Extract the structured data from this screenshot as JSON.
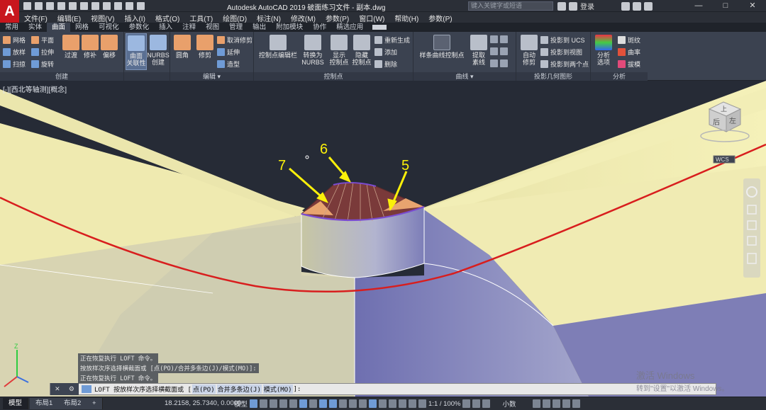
{
  "app": {
    "logo": "A",
    "title": "Autodesk AutoCAD 2019    破面练习文件 - 副本.dwg",
    "search_placeholder": "键入关键字或短语",
    "login": "登录",
    "win_controls": [
      "—",
      "□",
      "✕"
    ]
  },
  "menu": [
    "文件(F)",
    "编辑(E)",
    "视图(V)",
    "插入(I)",
    "格式(O)",
    "工具(T)",
    "绘图(D)",
    "标注(N)",
    "修改(M)",
    "参数(P)",
    "窗口(W)",
    "帮助(H)",
    "参数(P)"
  ],
  "tabs": [
    "常用",
    "实体",
    "曲面",
    "网格",
    "可视化",
    "参数化",
    "插入",
    "注释",
    "视图",
    "管理",
    "输出",
    "附加模块",
    "协作",
    "精选应用"
  ],
  "active_tab": "曲面",
  "ribbon": {
    "create_small": [
      "网格",
      "平面",
      "放样",
      "拉伸",
      "扫掠",
      "旋转"
    ],
    "create_big": [
      "过渡",
      "修补",
      "偏移",
      "曲面\n关联性",
      "NURBS\n创建"
    ],
    "create_title": "创建",
    "edit_big": [
      "圆角",
      "修剪"
    ],
    "edit_small": [
      "取消修剪",
      "延伸",
      "造型"
    ],
    "edit_title": "编辑 ▾",
    "cp_big": [
      "控制点编辑栏",
      "转换为\nNURBS",
      "显示\n控制点",
      "隐藏\n控制点"
    ],
    "cp_small": [
      "重新生成",
      "添加",
      "删除"
    ],
    "cp_title": "控制点",
    "curve_big": [
      "样条曲线控制点",
      "提取\n素线"
    ],
    "curve_title": "曲线 ▾",
    "proj_big": [
      "自动\n修剪"
    ],
    "proj_small": [
      "投影到 UCS",
      "投影到视图",
      "投影到两个点"
    ],
    "proj_title": "投影几何图形",
    "anal_big": [
      "分析\n选项"
    ],
    "anal_small": [
      "斑纹",
      "曲率",
      "拔模"
    ],
    "anal_title": "分析"
  },
  "viewport": {
    "label": "[-][西北等轴测][概念]",
    "viewcube_top": "上",
    "viewcube_left": "后",
    "viewcube_right": "左",
    "wcs": "WCS",
    "annotations": [
      "7",
      "6",
      "5"
    ]
  },
  "command_history": [
    "正在恢复执行 LOFT 命令。",
    "按放样次序选择横截面或 [点(PO)/合并多条边(J)/模式(MO)]:",
    "正在恢复执行 LOFT 命令。"
  ],
  "command_line": {
    "prefix": "LOFT 按放样次序选择横截面或 [",
    "opt1": "点(PO)",
    "opt2": "合并多条边(J)",
    "opt3": "模式(MO)",
    "suffix": "]:"
  },
  "statusbar": {
    "layout_tabs": [
      "模型",
      "布局1",
      "布局2",
      "+"
    ],
    "coords": "18.2158, 25.7340, 0.0000",
    "model": "模型",
    "scale": "1:1 / 100%",
    "units": "小数"
  },
  "watermark": {
    "line1": "激活 Windows",
    "line2": "转到\"设置\"以激活 Windows。"
  },
  "colors": {
    "surface_yellow": "#f3efb2",
    "surface_blue": "#7d7cb6",
    "red_curve": "#d81e1e",
    "arrow_yellow": "#fbf00a",
    "background": "#262b36"
  }
}
